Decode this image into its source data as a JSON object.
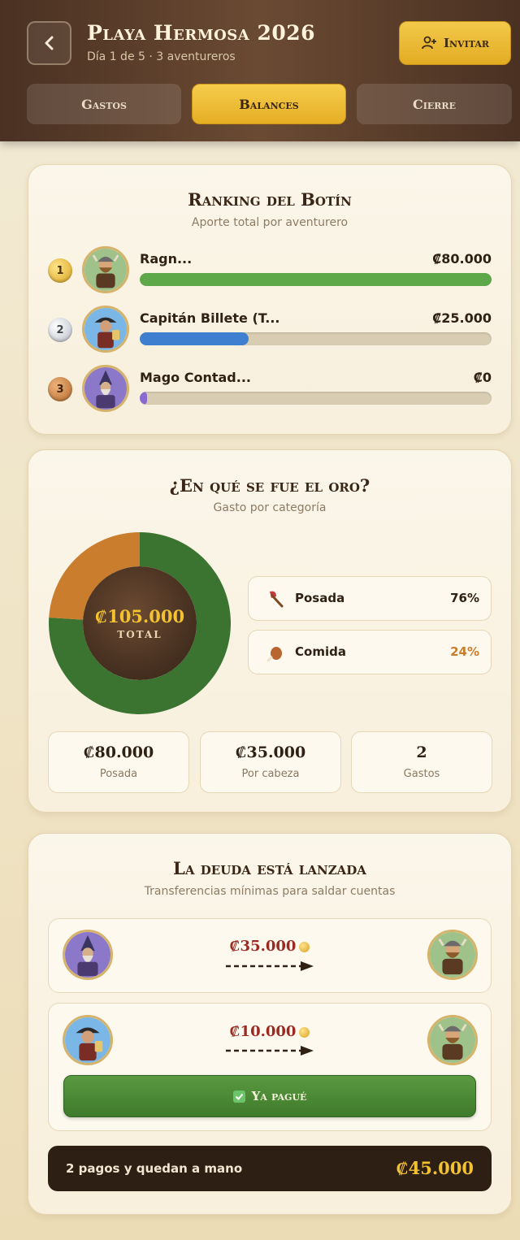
{
  "header": {
    "back_icon": "chevron-left-icon",
    "title": "Playa Hermosa 2026",
    "subtitle": "Día 1 de 5 · 3 aventureros",
    "invite_label": "Invitar",
    "invite_icon": "add-user-icon",
    "tabs": [
      {
        "label": "Gastos",
        "active": false
      },
      {
        "label": "Balances",
        "active": true
      },
      {
        "label": "Cierre",
        "active": false
      }
    ]
  },
  "ranking": {
    "title": "Ranking del Botín",
    "subtitle": "Aporte total por aventurero",
    "items": [
      {
        "rank": "1",
        "name": "Ragn...",
        "amount": "₡80.000",
        "progress": 1.0,
        "color": "#5fa84a",
        "avatar": "viking-avatar"
      },
      {
        "rank": "2",
        "name": "Capitán Billete (T...",
        "amount": "₡25.000",
        "progress": 0.31,
        "color": "#3f7fd0",
        "avatar": "pirate-avatar"
      },
      {
        "rank": "3",
        "name": "Mago Contad...",
        "amount": "₡0",
        "progress": 0.02,
        "color": "#8a6ad0",
        "avatar": "wizard-avatar"
      }
    ]
  },
  "categories": {
    "title": "¿En qué se fue el oro?",
    "subtitle": "Gasto por categoría",
    "total": "₡105.000",
    "total_label": "TOTAL",
    "items": [
      {
        "label": "Posada",
        "pct": "76%",
        "fraction": 0.76,
        "icon": "axe-icon",
        "color": "#3b7331",
        "pct_color": "#2f2114"
      },
      {
        "label": "Comida",
        "pct": "24%",
        "fraction": 0.24,
        "icon": "meat-icon",
        "color": "#c97d2d",
        "pct_color": "#c97d2d"
      }
    ],
    "stats": [
      {
        "value": "₡80.000",
        "label": "Posada"
      },
      {
        "value": "₡35.000",
        "label": "Por cabeza"
      },
      {
        "value": "2",
        "label": "Gastos"
      }
    ]
  },
  "debts": {
    "title": "La deuda está lanzada",
    "subtitle": "Transferencias mínimas para saldar cuentas",
    "transfers": [
      {
        "amount": "₡35.000",
        "from": "wizard-avatar",
        "to": "viking-avatar"
      },
      {
        "amount": "₡10.000",
        "from": "pirate-avatar",
        "to": "viking-avatar",
        "action": "Ya pagué"
      }
    ],
    "summary_text": "2 pagos y quedan a mano",
    "summary_total": "₡45.000"
  }
}
